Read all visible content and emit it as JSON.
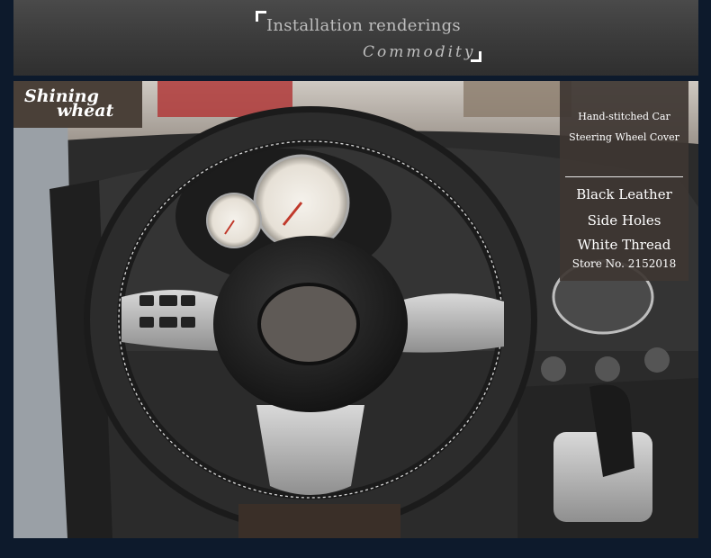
{
  "banner": {
    "heading": "Installation renderings",
    "subheading": "Commodity"
  },
  "logo": {
    "line1": "Shining",
    "line2": "wheat"
  },
  "info_box": {
    "title_line1": "Hand-stitched Car",
    "title_line2": "Steering Wheel Cover",
    "features": [
      "Black Leather",
      "Side Holes",
      "White Thread"
    ],
    "store": "Store No. 2152018"
  },
  "photo": {
    "subject": "steering-wheel-cover-installed",
    "colors": {
      "leather": "#1b1b1b",
      "stitching": "#d9d9d9",
      "dash": "#2b2b2b",
      "spoke_silver": "#b8b8b8"
    }
  }
}
